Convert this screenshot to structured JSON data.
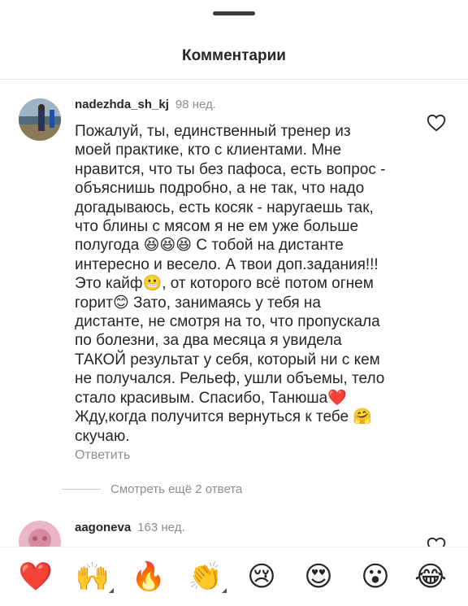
{
  "header": {
    "title": "Комментарии"
  },
  "comments": [
    {
      "username": "nadezhda_sh_kj",
      "time": "98 нед.",
      "text": "Пожалуй, ты, единственный тренер из\nмоей практике, кто с клиентами. Мне\nнравится, что ты без пафоса, есть вопрос -\nобъяснишь подробно, а не так, что надо\nдогадываюсь, есть косяк - наругаешь так,\nчто блины с мясом я не ем уже больше\nполугода 😆😆😆 С тобой на дистанте\nинтересно и весело. А твои доп.задания!!!\nЭто кайф😬, от которого всё потом огнем\nгорит😊 Зато, занимаясь у тебя на\nдистанте, не смотря на то, что пропускала\nпо болезни, за два месяца я увидела\nТАКОЙ результат у себя, который ни с кем\nне получался. Рельеф, ушли объемы, тело\nстало красивым. Спасибо, Танюша❤️\nЖду,когда получится вернуться к тебе 🤗\nскучаю.",
      "reply_label": "Ответить",
      "view_replies_label": "Смотреть ещё 2 ответа"
    },
    {
      "username": "aagoneva",
      "time": "163 нед."
    }
  ],
  "reactions": [
    {
      "emoji": "❤️",
      "name": "heart"
    },
    {
      "emoji": "🙌",
      "name": "raising-hands"
    },
    {
      "emoji": "🔥",
      "name": "fire"
    },
    {
      "emoji": "👏",
      "name": "clapping-hands"
    },
    {
      "emoji": "😢",
      "name": "crying-face"
    },
    {
      "emoji": "😍",
      "name": "heart-eyes"
    },
    {
      "emoji": "😮",
      "name": "surprised-face"
    },
    {
      "emoji": "😂",
      "name": "tears-of-joy"
    }
  ],
  "colors": {
    "text": "#262626",
    "secondary": "#8e8e8e",
    "divider": "#e6e6e6"
  }
}
